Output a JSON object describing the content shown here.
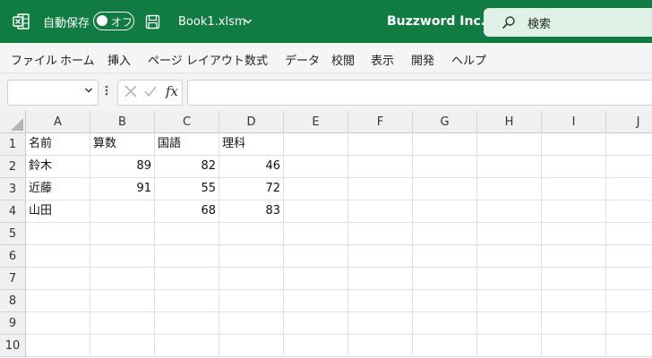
{
  "titlebar": {
    "app_icon": "excel-icon",
    "autosave_label": "自動保存",
    "autosave_state": "オフ",
    "save_icon": "save-icon",
    "doc_name": "Book1.xlsm",
    "company": "Buzzword Inc.",
    "search_placeholder": "検索",
    "accent": "#107c41"
  },
  "menu": {
    "items": [
      "ファイル",
      "ホーム",
      "挿入",
      "ページ レイアウト",
      "数式",
      "データ",
      "校閲",
      "表示",
      "開発",
      "ヘルプ"
    ]
  },
  "formula_bar": {
    "name_box": "",
    "cancel_icon": "cancel-icon",
    "enter_icon": "check-icon",
    "fx": "fx",
    "formula": ""
  },
  "grid": {
    "columns": [
      "A",
      "B",
      "C",
      "D",
      "E",
      "F",
      "G",
      "H",
      "I",
      "J"
    ],
    "rows": [
      "1",
      "2",
      "3",
      "4",
      "5",
      "6",
      "7",
      "8",
      "9",
      "10"
    ],
    "cells": [
      [
        "名前",
        "算数",
        "国語",
        "理科",
        "",
        "",
        "",
        "",
        "",
        ""
      ],
      [
        "鈴木",
        "89",
        "82",
        "46",
        "",
        "",
        "",
        "",
        "",
        ""
      ],
      [
        "近藤",
        "91",
        "55",
        "72",
        "",
        "",
        "",
        "",
        "",
        ""
      ],
      [
        "山田",
        "",
        "68",
        "83",
        "",
        "",
        "",
        "",
        "",
        ""
      ],
      [
        "",
        "",
        "",
        "",
        "",
        "",
        "",
        "",
        "",
        ""
      ],
      [
        "",
        "",
        "",
        "",
        "",
        "",
        "",
        "",
        "",
        ""
      ],
      [
        "",
        "",
        "",
        "",
        "",
        "",
        "",
        "",
        "",
        ""
      ],
      [
        "",
        "",
        "",
        "",
        "",
        "",
        "",
        "",
        "",
        ""
      ],
      [
        "",
        "",
        "",
        "",
        "",
        "",
        "",
        "",
        "",
        ""
      ],
      [
        "",
        "",
        "",
        "",
        "",
        "",
        "",
        "",
        "",
        ""
      ]
    ]
  }
}
